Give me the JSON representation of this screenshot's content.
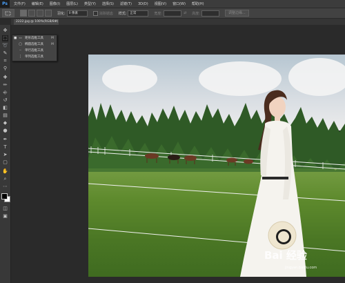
{
  "app": {
    "logo": "Ps"
  },
  "menubar": {
    "items": [
      {
        "label": "文件(F)"
      },
      {
        "label": "编辑(E)"
      },
      {
        "label": "图像(I)"
      },
      {
        "label": "图层(L)"
      },
      {
        "label": "类型(Y)"
      },
      {
        "label": "选择(S)"
      },
      {
        "label": "滤镜(T)"
      },
      {
        "label": "3D(D)"
      },
      {
        "label": "视图(V)"
      },
      {
        "label": "窗口(W)"
      },
      {
        "label": "帮助(H)"
      }
    ]
  },
  "options": {
    "feather_label": "羽化:",
    "feather_value": "0 像素",
    "antialias_label": "消除锯齿",
    "style_label": "样式:",
    "style_value": "正常",
    "width_label": "宽度:",
    "height_label": "高度:",
    "refine_edge_label": "调整边缘..."
  },
  "document": {
    "tab_title": "2222.jpg @ 100%(RGB/8#)",
    "close_glyph": "×"
  },
  "flyout": {
    "items": [
      {
        "label": "矩形选框工具",
        "shortcut": "M",
        "icon": "rect-marquee-icon",
        "glyph": "▭",
        "selected": true
      },
      {
        "label": "椭圆选框工具",
        "shortcut": "M",
        "icon": "ellipse-marquee-icon",
        "glyph": "◯",
        "selected": false
      },
      {
        "label": "单行选框工具",
        "shortcut": "",
        "icon": "single-row-marquee-icon",
        "glyph": "┄",
        "selected": false
      },
      {
        "label": "单列选框工具",
        "shortcut": "",
        "icon": "single-column-marquee-icon",
        "glyph": "┊",
        "selected": false
      }
    ],
    "selected_mark": "■"
  },
  "toolbox": {
    "tools": [
      {
        "name": "move-tool-icon",
        "glyph": "✥"
      },
      {
        "name": "marquee-tool-icon",
        "glyph": "⬚",
        "active": true
      },
      {
        "name": "lasso-tool-icon",
        "glyph": "➰"
      },
      {
        "name": "quick-selection-tool-icon",
        "glyph": "✎"
      },
      {
        "name": "crop-tool-icon",
        "glyph": "⌗"
      },
      {
        "name": "eyedropper-tool-icon",
        "glyph": "⚲"
      },
      {
        "name": "healing-brush-tool-icon",
        "glyph": "✚"
      },
      {
        "name": "brush-tool-icon",
        "glyph": "✏"
      },
      {
        "name": "clone-stamp-tool-icon",
        "glyph": "⎆"
      },
      {
        "name": "history-brush-tool-icon",
        "glyph": "↺"
      },
      {
        "name": "eraser-tool-icon",
        "glyph": "◧"
      },
      {
        "name": "gradient-tool-icon",
        "glyph": "▤"
      },
      {
        "name": "blur-tool-icon",
        "glyph": "◆"
      },
      {
        "name": "dodge-tool-icon",
        "glyph": "●"
      },
      {
        "name": "pen-tool-icon",
        "glyph": "✒"
      },
      {
        "name": "type-tool-icon",
        "glyph": "T"
      },
      {
        "name": "path-selection-tool-icon",
        "glyph": "➤"
      },
      {
        "name": "shape-tool-icon",
        "glyph": "▢"
      },
      {
        "name": "hand-tool-icon",
        "glyph": "✋"
      },
      {
        "name": "zoom-tool-icon",
        "glyph": "⌕"
      },
      {
        "name": "more-tools-icon",
        "glyph": "⋯"
      }
    ],
    "lower_tools": [
      {
        "name": "quick-mask-icon",
        "glyph": "◫"
      },
      {
        "name": "screen-mode-icon",
        "glyph": "▣"
      }
    ]
  },
  "watermark": {
    "text": "Bai 经验",
    "subtext": "jingyan.baidu.com"
  },
  "colors": {
    "foreground": "#000000",
    "background": "#ffffff"
  }
}
